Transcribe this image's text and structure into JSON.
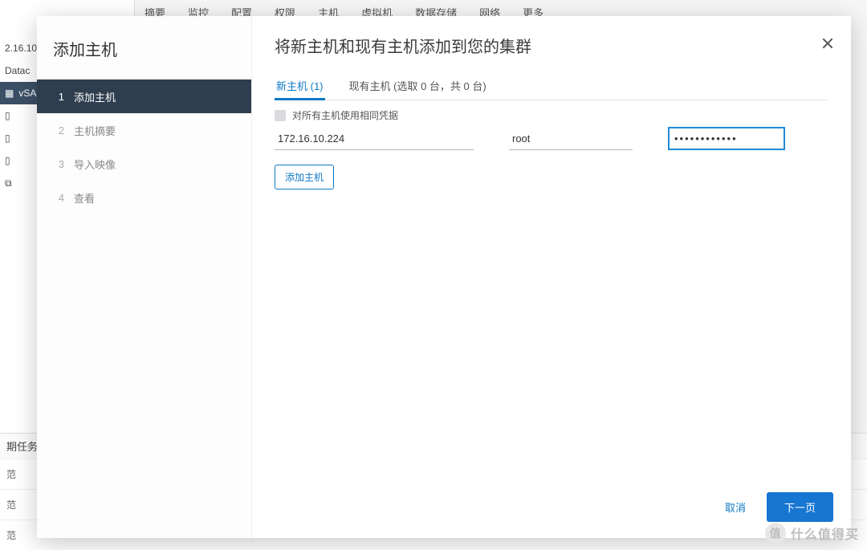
{
  "bg": {
    "tree": {
      "ip": "2.16.10.",
      "dc": "Datac",
      "cluster": "vSA"
    },
    "tabs": [
      "摘要",
      "监控",
      "配置",
      "权限",
      "主机",
      "虚拟机",
      "数据存储",
      "网络",
      "更多"
    ],
    "tasks_header": "期任务",
    "task_cell": "范"
  },
  "wizard": {
    "sidebar_title": "添加主机",
    "steps": [
      {
        "num": "1",
        "label": "添加主机"
      },
      {
        "num": "2",
        "label": "主机摘要"
      },
      {
        "num": "3",
        "label": "导入映像"
      },
      {
        "num": "4",
        "label": "查看"
      }
    ],
    "active_step": 0,
    "title": "将新主机和现有主机添加到您的集群",
    "tabs": {
      "new_label": "新主机 (1)",
      "existing_label": "现有主机 (选取 0 台，共 0 台)",
      "active": "new"
    },
    "same_credentials_label": "对所有主机使用相同凭据",
    "host": {
      "ip": "172.16.10.224",
      "user": "root",
      "password_mask": "••••••••••••"
    },
    "add_button": "添加主机",
    "footer": {
      "cancel": "取消",
      "next": "下一页"
    }
  },
  "watermark": {
    "glyph": "值",
    "text": "什么值得买"
  }
}
